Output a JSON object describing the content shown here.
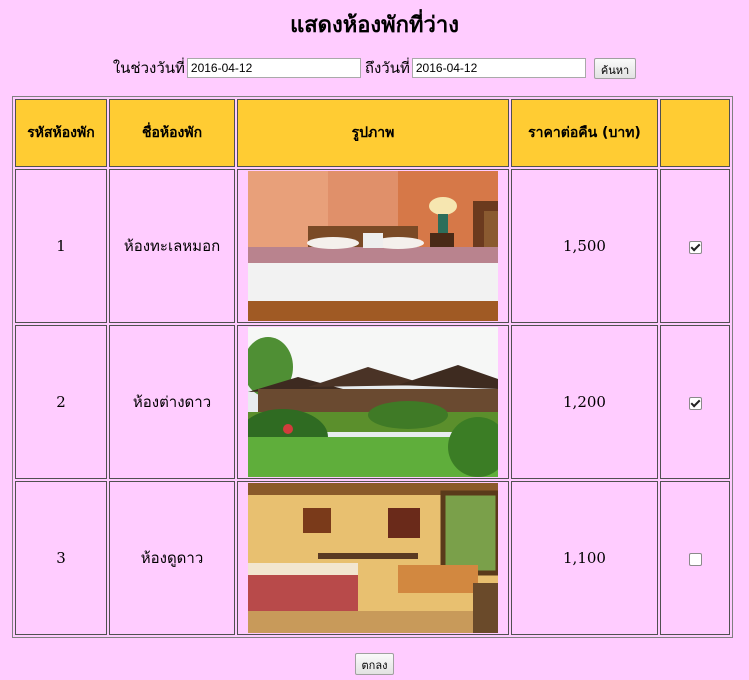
{
  "page": {
    "title": "แสดงห้องพักที่ว่าง"
  },
  "search": {
    "from_label": "ในช่วงวันที่",
    "from_value": "2016-04-12",
    "to_label": "ถึงวันที่",
    "to_value": "2016-04-12",
    "button": "ค้นหา"
  },
  "table": {
    "headers": [
      "รหัสห้องพัก",
      "ชื่อห้องพัก",
      "รูปภาพ",
      "ราคาต่อคืน (บาท)",
      ""
    ],
    "rows": [
      {
        "id": "1",
        "name": "ห้องทะเลหมอก",
        "price": "1,500",
        "checked": true,
        "photo": "bedroom-photo"
      },
      {
        "id": "2",
        "name": "ห้องต่างดาว",
        "price": "1,200",
        "checked": true,
        "photo": "resort-garden-photo"
      },
      {
        "id": "3",
        "name": "ห้องดูดาว",
        "price": "1,100",
        "checked": false,
        "photo": "room-interior-photo"
      }
    ]
  },
  "footer": {
    "ok_button": "ตกลง"
  },
  "colors": {
    "background": "#ffccff",
    "header": "#ffcc33"
  }
}
